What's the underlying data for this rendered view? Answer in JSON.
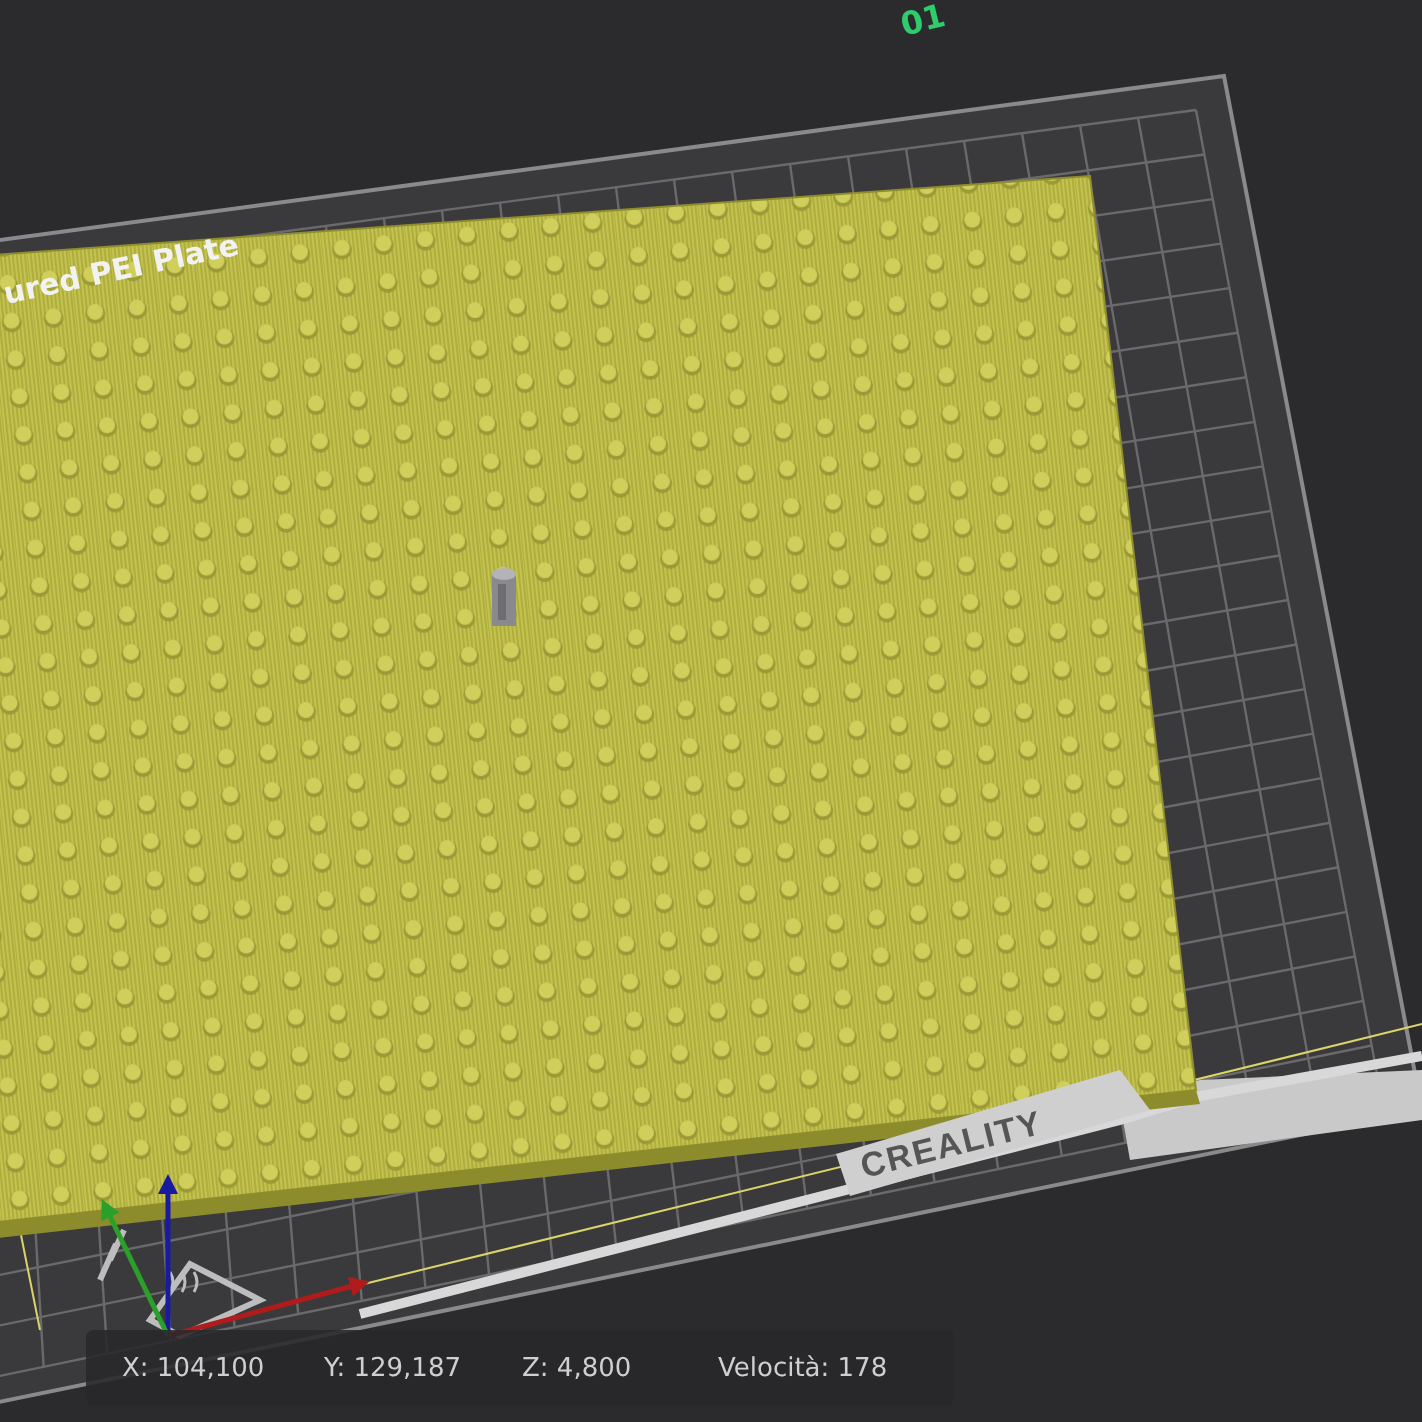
{
  "plate": {
    "number": "01",
    "name": "ured PEI Plate",
    "brand": "CREALITY"
  },
  "status_bar": [
    "X: 104,100",
    "Y: 129,187",
    "Z: 4,800",
    "Velocità: 178"
  ]
}
